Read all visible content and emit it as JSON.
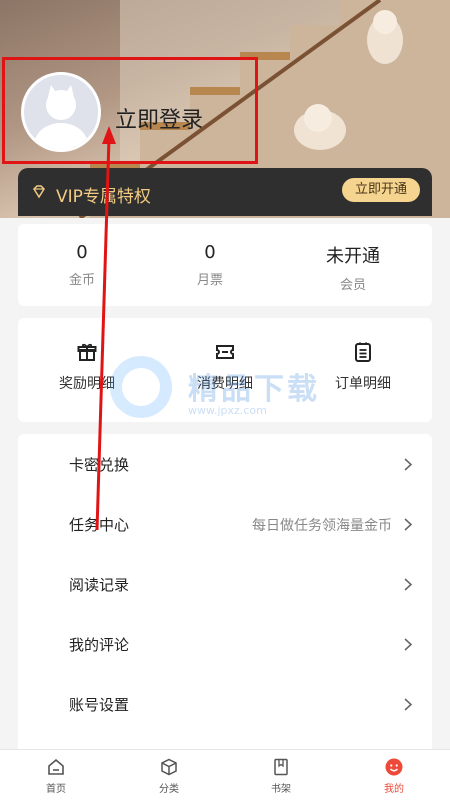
{
  "header": {
    "login_text": "立即登录",
    "avatar_icon": "default-avatar-icon"
  },
  "vip": {
    "label": "VIP专属特权",
    "button": "立即开通",
    "icon": "diamond-icon",
    "accent": "#f2cb83"
  },
  "stats": [
    {
      "value": "0",
      "label": "金币"
    },
    {
      "value": "0",
      "label": "月票"
    },
    {
      "value": "未开通",
      "label": "会员"
    }
  ],
  "details": [
    {
      "label": "奖励明细",
      "icon": "gift-icon"
    },
    {
      "label": "消费明细",
      "icon": "ticket-icon"
    },
    {
      "label": "订单明细",
      "icon": "order-list-icon"
    }
  ],
  "watermark": {
    "text": "精品下载",
    "url": "www.jpxz.com"
  },
  "menu": [
    {
      "title": "卡密兑换",
      "sub": ""
    },
    {
      "title": "任务中心",
      "sub": "每日做任务领海量金币"
    },
    {
      "title": "阅读记录",
      "sub": ""
    },
    {
      "title": "我的评论",
      "sub": ""
    },
    {
      "title": "账号设置",
      "sub": ""
    }
  ],
  "tabs": [
    {
      "label": "首页",
      "icon": "home-icon"
    },
    {
      "label": "分类",
      "icon": "category-cube-icon"
    },
    {
      "label": "书架",
      "icon": "bookshelf-icon"
    },
    {
      "label": "我的",
      "icon": "profile-face-icon",
      "active": true
    }
  ],
  "colors": {
    "annotation": "#e01414",
    "active_tab": "#ee4a3a"
  }
}
